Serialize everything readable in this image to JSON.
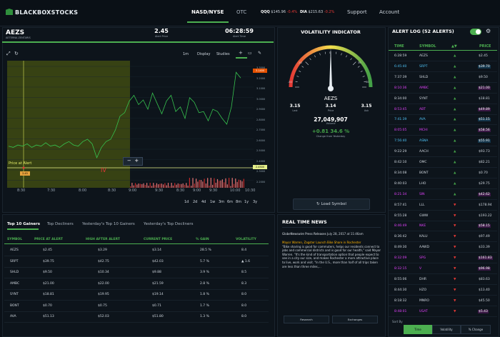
{
  "nav": {
    "logo": "BLACKBOXSTOCKS",
    "tabs": [
      "NASD/NYSE",
      "OTC"
    ],
    "indices": [
      {
        "name": "QQQ",
        "value": "$145.96",
        "change": "-0.4%"
      },
      {
        "name": "DIA",
        "value": "$215.63",
        "change": "-0.2%"
      }
    ],
    "support": "Support",
    "account": "Account"
  },
  "chart": {
    "symbol": "AEZS",
    "company": "AETERNA ZENTARIS",
    "price": "2.45",
    "price_label": "Alert Price",
    "time": "06:28:59",
    "time_label": "Alert Time",
    "toolbar": {
      "interval": "1m",
      "display": "Display",
      "studies": "Studies"
    },
    "price_at_alert": "Price at Alert",
    "y_ticks": [
      "3.3000",
      "3.2000",
      "3.1000",
      "3.0000",
      "2.9000",
      "2.8000",
      "2.7000",
      "2.6000",
      "2.5000",
      "2.4000",
      "2.3000",
      "2.2000"
    ],
    "price_tag_top": "3.1400",
    "price_tag_bottom": "2.4500",
    "x_ticks": [
      "8:30",
      "7:30",
      "8:00",
      "8:30",
      "9:00",
      "9:30",
      "8:30",
      "9:00",
      "9:30",
      "10:00",
      "10:30"
    ],
    "ranges": [
      "1d",
      "2d",
      "4d",
      "1w",
      "3m",
      "6m",
      "8m",
      "1y",
      "3y"
    ]
  },
  "chart_data": {
    "type": "line",
    "x": [
      0,
      2,
      4,
      6,
      8,
      10,
      12,
      14,
      16,
      18,
      20,
      22,
      24,
      26,
      28,
      30,
      32,
      34,
      36,
      38,
      40,
      42,
      44,
      46,
      48,
      50,
      52,
      54,
      56,
      58,
      60,
      62,
      64,
      66,
      68,
      70,
      72,
      74,
      76,
      78,
      80,
      82,
      84,
      86,
      88,
      90,
      92,
      94,
      96,
      98,
      100
    ],
    "series": [
      {
        "values": [
          2.56,
          2.55,
          2.57,
          2.56,
          2.58,
          2.55,
          2.57,
          2.56,
          2.59,
          2.56,
          2.57,
          2.55,
          2.58,
          2.6,
          2.57,
          2.56,
          2.6,
          2.62,
          2.58,
          2.46,
          2.55,
          2.6,
          2.62,
          2.7,
          2.82,
          2.85,
          2.95,
          3.0,
          2.92,
          2.96,
          2.88,
          3.02,
          2.93,
          2.84,
          2.95,
          3.0,
          2.86,
          2.9,
          2.8,
          2.98,
          2.94,
          2.85,
          2.86,
          2.78,
          2.88,
          2.86,
          2.8,
          2.75,
          2.9,
          3.2,
          3.15
        ]
      }
    ],
    "ylim": [
      2.2,
      3.3
    ]
  },
  "volatility": {
    "title": "VOLATILITY INDICATOR",
    "gauge_ticks": [
      "-50",
      "-30",
      "0",
      "30",
      "50"
    ],
    "gauge_value": 0,
    "symbol": "AEZS",
    "stats": [
      {
        "value": "3.15",
        "label": "Last"
      },
      {
        "value": "3.14",
        "label": "Price"
      },
      {
        "value": "3.15",
        "label": "Ask"
      }
    ],
    "volume": "27,049,907",
    "volume_label": "Volume",
    "change": "+0.81  34.6 %",
    "change_label": "Change from Yesterday",
    "load_button": "Load Symbol"
  },
  "alert_log": {
    "title": "ALERT LOG (52 ALERTS)",
    "columns": [
      "TIME",
      "SYMBOL",
      "▲▼",
      "PRICE"
    ],
    "rows": [
      {
        "time": "6:28:59",
        "symbol": "AEZS",
        "dir": "up",
        "price": "$2.45",
        "hl": "none"
      },
      {
        "time": "6:45:40",
        "symbol": "SRPT",
        "dir": "up",
        "price": "$39.70",
        "hl": "blue"
      },
      {
        "time": "7:37:39",
        "symbol": "SHLD",
        "dir": "up",
        "price": "$9.50",
        "hl": "none"
      },
      {
        "time": "8:10:36",
        "symbol": "AMBC",
        "dir": "up",
        "price": "$21.00",
        "hl": "purple"
      },
      {
        "time": "8:34:00",
        "symbol": "SYNT",
        "dir": "up",
        "price": "$18.81",
        "hl": "none"
      },
      {
        "time": "8:53:45",
        "symbol": "ABT",
        "dir": "up",
        "price": "$49.89",
        "hl": "purple"
      },
      {
        "time": "7:41:39",
        "symbol": "AVA",
        "dir": "up",
        "price": "$51.15",
        "hl": "blue"
      },
      {
        "time": "8:05:05",
        "symbol": "MCHI",
        "dir": "up",
        "price": "$58.56",
        "hl": "purple"
      },
      {
        "time": "7:56:40",
        "symbol": "ASNA",
        "dir": "up",
        "price": "$55.91",
        "hl": "blue"
      },
      {
        "time": "9:22:29",
        "symbol": "AACH",
        "dir": "up",
        "price": "$93.73",
        "hl": "none"
      },
      {
        "time": "8:42:10",
        "symbol": "OMC",
        "dir": "up",
        "price": "$82.21",
        "hl": "none"
      },
      {
        "time": "8:34:08",
        "symbol": "BONT",
        "dir": "up",
        "price": "$0.70",
        "hl": "none"
      },
      {
        "time": "8:40:03",
        "symbol": "LHO",
        "dir": "up",
        "price": "$29.75",
        "hl": "none"
      },
      {
        "time": "8:21:34",
        "symbol": "SIN",
        "dir": "up",
        "price": "$42.62",
        "hl": "purple"
      },
      {
        "time": "8:57:41",
        "symbol": "LLL",
        "dir": "down",
        "price": "$178.94",
        "hl": "none"
      },
      {
        "time": "8:55:28",
        "symbol": "GWW",
        "dir": "down",
        "price": "$193.22",
        "hl": "none"
      },
      {
        "time": "8:46:49",
        "symbol": "NKE",
        "dir": "down",
        "price": "$58.15",
        "hl": "purple"
      },
      {
        "time": "8:36:42",
        "symbol": "KALU",
        "dir": "down",
        "price": "$97.49",
        "hl": "none"
      },
      {
        "time": "8:49:30",
        "symbol": "AAWD",
        "dir": "down",
        "price": "$33.39",
        "hl": "none"
      },
      {
        "time": "8:32:09",
        "symbol": "SPG",
        "dir": "down",
        "price": "$161.83",
        "hl": "purple"
      },
      {
        "time": "8:32:15",
        "symbol": "V",
        "dir": "down",
        "price": "$96.98",
        "hl": "purple"
      },
      {
        "time": "8:55:06",
        "symbol": "DHR",
        "dir": "down",
        "price": "$83.63",
        "hl": "none"
      },
      {
        "time": "8:44:30",
        "symbol": "HZO",
        "dir": "down",
        "price": "$13.40",
        "hl": "none"
      },
      {
        "time": "8:18:32",
        "symbol": "MNRO",
        "dir": "down",
        "price": "$45.50",
        "hl": "none"
      },
      {
        "time": "8:48:01",
        "symbol": "USAT",
        "dir": "down",
        "price": "$5.43",
        "hl": "purple"
      }
    ],
    "sort_label": "Sort By",
    "sort_options": [
      "Time",
      "Volatility",
      "% Change"
    ]
  },
  "gainers": {
    "tabs": [
      "Top 10 Gainers",
      "Top Decliners",
      "Yesterday's Top 10 Gainers",
      "Yesterday's Top Decliners"
    ],
    "columns": [
      "SYMBOL",
      "PRICE AT ALERT",
      "HIGH AFTER ALERT",
      "CURRENT PRICE",
      "% GAIN",
      "VOLATILITY"
    ],
    "rows": [
      [
        "AEZS",
        "$2.45",
        "$3.29",
        "$3.14",
        "28.5 %",
        "8.4"
      ],
      [
        "SRPT",
        "$39.75",
        "$42.75",
        "$42.03",
        "5.7 %",
        "▲ 1.6"
      ],
      [
        "SHLD",
        "$9.50",
        "$10.34",
        "$9.88",
        "3.9 %",
        "8.5"
      ],
      [
        "AMBC",
        "$21.00",
        "$22.00",
        "$21.59",
        "2.8 %",
        "8.3"
      ],
      [
        "SYNT",
        "$18.81",
        "$19.95",
        "$19.14",
        "1.8 %",
        "8.0"
      ],
      [
        "BONT",
        "$0.70",
        "$0.75",
        "$0.71",
        "1.7 %",
        "8.0"
      ],
      [
        "AVA",
        "$51.13",
        "$52.03",
        "$51.80",
        "1.3 %",
        "8.0"
      ]
    ]
  },
  "news": {
    "title": "REAL TIME NEWS",
    "source": "GlobeNewswire Press Releases",
    "date": "July 28, 2017 at 11:46am",
    "headline": "Mayor Warren, Zagster Launch Bike Share in Rochester",
    "body": "\"Bike sharing is good for commuters, helps our residents connect to jobs and commercial districts and is good for our health,\" said Mayor Warren. \"It's the kind of transportation option that people expect to see in a city our size, and makes Rochester a more attractive place to live, work and visit. \"In the U.S., more than half of all trips taken are less than three miles,...",
    "buttons": [
      "Research",
      "Exchanges"
    ]
  }
}
